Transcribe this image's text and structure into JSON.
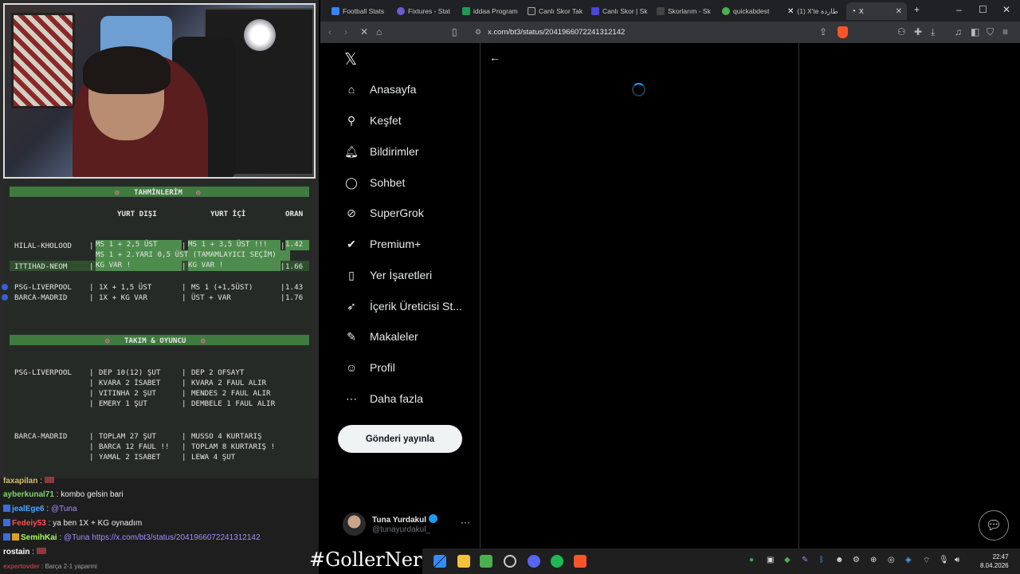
{
  "overlay": {
    "section1_title": "TAHMİNLERİM",
    "col_headers": {
      "yurt_disi": "YURT DIŞI",
      "yurt_ici": "YURT İÇİ",
      "oran": "ORAN"
    },
    "rows": [
      {
        "match": "HILAL-KHOLOOD",
        "yurt_disi": "MS 1 + 2,5 ÜST",
        "yurt_ici": "MS 1 + 3,5 ÜST !!!",
        "oran": "1.42",
        "extra": "MS 1 + 2.YARI 0,5 ÜST (TAMAMLAYICI SEÇİM)"
      },
      {
        "match": "ITTIHAD-NEOM",
        "yurt_disi": "KG VAR !",
        "yurt_ici": "KG VAR !",
        "oran": "1.66"
      },
      {
        "match": "PSG-LIVERPOOL",
        "yurt_disi": "1X + 1,5 ÜST",
        "yurt_ici": "MS 1 (+1,5ÜST)",
        "oran": "1.43"
      },
      {
        "match": "BARCA-MADRID",
        "yurt_disi": "1X + KG VAR",
        "yurt_ici": "ÜST + VAR",
        "oran": "1.76"
      }
    ],
    "section2_title": "TAKIM & OYUNCU",
    "player_blocks": [
      {
        "match": "PSG-LIVERPOOL",
        "lines": [
          [
            "DEP 10(12) ŞUT",
            "DEP 2 OFSAYT"
          ],
          [
            "KVARA 2 İSABET",
            "KVARA 2 FAUL ALIR"
          ],
          [
            "VITINHA 2 ŞUT",
            "MENDES 2 FAUL ALIR"
          ],
          [
            "EMERY 1 ŞUT",
            "DEMBELE 1 FAUL ALIR"
          ]
        ]
      },
      {
        "match": "BARCA-MADRID",
        "lines": [
          [
            "TOPLAM 27 ŞUT",
            "MUSSO 4 KURTARIŞ"
          ],
          [
            "BARCA 12 FAUL !!",
            "TOPLAM 8 KURTARIŞ !"
          ],
          [
            "YAMAL 2 ISABET",
            "LEWA 4 ŞUT"
          ]
        ]
      }
    ]
  },
  "chat": [
    {
      "user": "faxapilan",
      "user_color": "#d7c16a",
      "text": ""
    },
    {
      "user": "ayberkunal71",
      "user_color": "#7fd66a",
      "text": "kombo gelsin bari"
    },
    {
      "user": "jealEge6",
      "user_color": "#4aa8ff",
      "text": "@Tuna"
    },
    {
      "user": "Fedeiy53",
      "user_color": "#ff4d4d",
      "text": "ya ben 1X + KG oynadım"
    },
    {
      "user": "SemihKai",
      "user_color": "#a6ff5a",
      "text": "@Tuna",
      "link": "https://x.com/bt3/status/2041966072241312142"
    },
    {
      "user": "rostain",
      "user_color": "#ffffff",
      "text": ""
    },
    {
      "user": "expertovder",
      "user_color": "#ff5a5a",
      "text": "Barça 2-1 yaparmi"
    }
  ],
  "hashtag": "#GollerNerede",
  "browser": {
    "tabs": [
      {
        "label": "Football Stats",
        "color": "#3b82f6"
      },
      {
        "label": "Fixtures - Stat",
        "color": "#6d5bd0"
      },
      {
        "label": "iddaa Program",
        "color": "#1e9c55"
      },
      {
        "label": "Canlı Skor Tak",
        "color": "#2a2a2a"
      },
      {
        "label": "Canlı Skor | Sk",
        "color": "#4a47d6"
      },
      {
        "label": "Skorlarım - Sk",
        "color": "#444444"
      },
      {
        "label": "quickabdest",
        "color": "#4caf50"
      },
      {
        "label": "(1) X'te ﻃﺎﺭﺩﺓ",
        "color": "#000000"
      },
      {
        "label": "X",
        "color": "#000000",
        "active": true
      }
    ],
    "url": "x.com/bt3/status/2041966072241312142"
  },
  "x": {
    "nav": [
      {
        "label": "Anasayfa",
        "icon": "home-icon",
        "glyph": "⌂"
      },
      {
        "label": "Keşfet",
        "icon": "search-icon",
        "glyph": "⚲"
      },
      {
        "label": "Bildirimler",
        "icon": "bell-icon",
        "glyph": "🔔︎"
      },
      {
        "label": "Sohbet",
        "icon": "chat-icon",
        "glyph": "◯"
      },
      {
        "label": "SuperGrok",
        "icon": "grok-icon",
        "glyph": "⊘"
      },
      {
        "label": "Premium+",
        "icon": "premium-icon",
        "glyph": "✔"
      },
      {
        "label": "Yer İşaretleri",
        "icon": "bookmark-icon",
        "glyph": "▯"
      },
      {
        "label": "İçerik Üreticisi St...",
        "icon": "rocket-icon",
        "glyph": "➶"
      },
      {
        "label": "Makaleler",
        "icon": "article-icon",
        "glyph": "✎"
      },
      {
        "label": "Profil",
        "icon": "profile-icon",
        "glyph": "☺"
      },
      {
        "label": "Daha fazla",
        "icon": "more-circle-icon",
        "glyph": "⋯"
      }
    ],
    "post_button": "Gönderi yayınla",
    "profile": {
      "name": "Tuna Yurdakul",
      "handle": "@tunayurdakul_"
    }
  },
  "clock": {
    "time": "22:47",
    "date": "8.04.2026"
  }
}
